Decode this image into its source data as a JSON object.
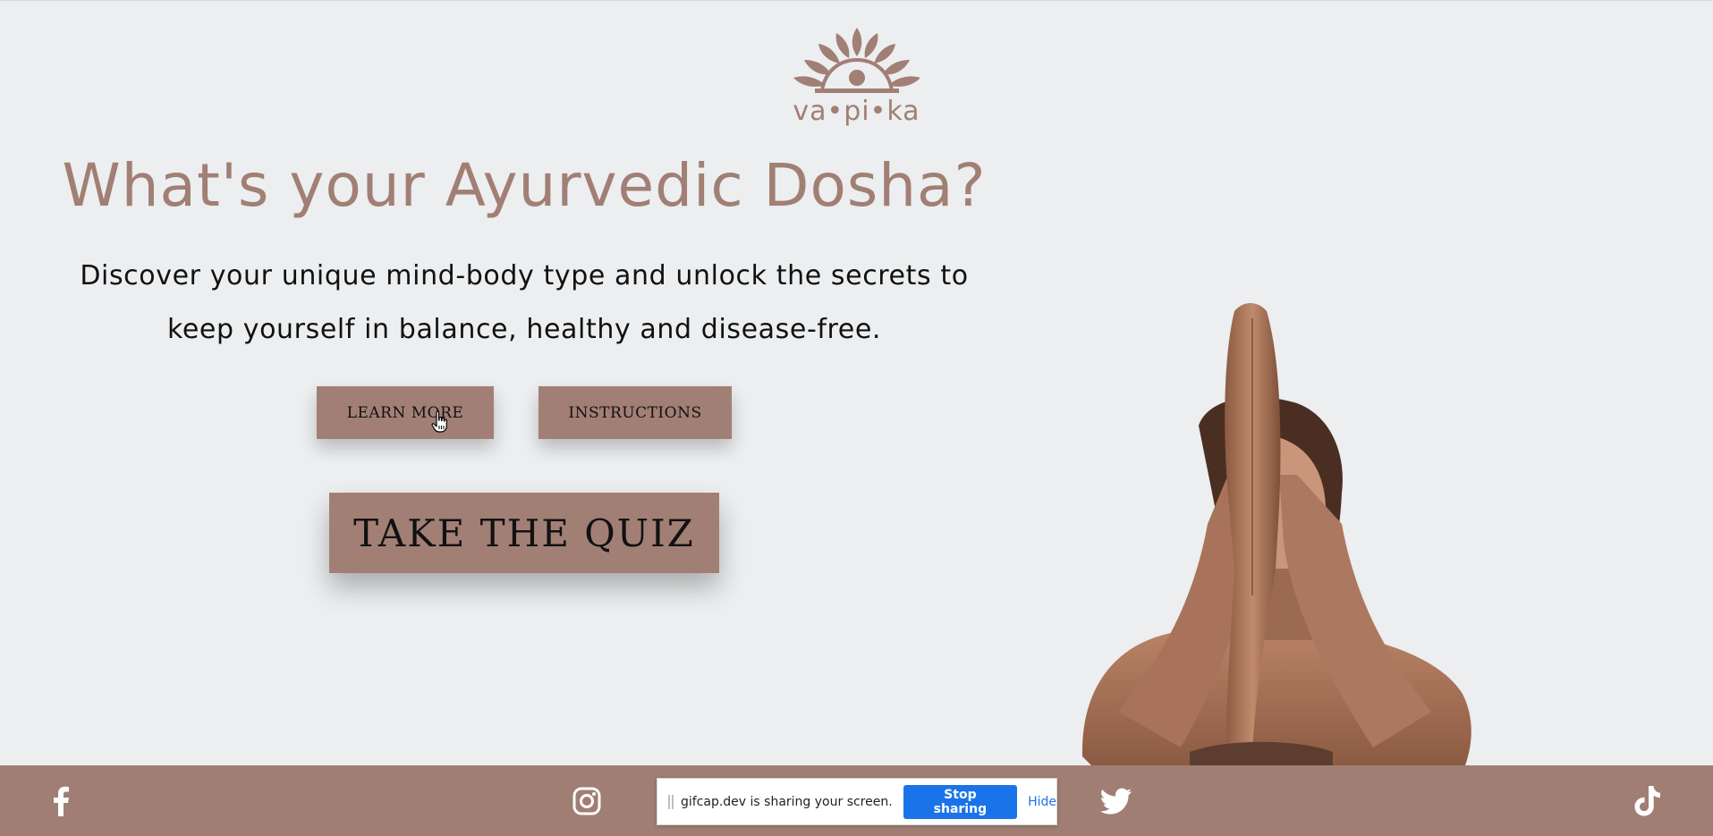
{
  "brand": {
    "logo_text": "va•pi•ka",
    "color": "#a27f74"
  },
  "hero": {
    "title": "What's your Ayurvedic Dosha?",
    "subtitle_line1": "Discover your unique mind-body type and unlock the secrets to",
    "subtitle_line2": "keep yourself in balance, healthy and disease-free."
  },
  "buttons": {
    "learn_more": "LEARN MORE",
    "instructions": "INSTRUCTIONS",
    "take_quiz": "TAKE THE QUIZ"
  },
  "footer": {
    "background": "#a07e73",
    "icons": [
      "facebook-icon",
      "instagram-icon",
      "twitter-icon",
      "tiktok-icon"
    ]
  },
  "screen_share": {
    "message": "gifcap.dev is sharing your screen.",
    "stop_label": "Stop sharing",
    "hide_label": "Hide",
    "accent": "#1a73e8"
  }
}
